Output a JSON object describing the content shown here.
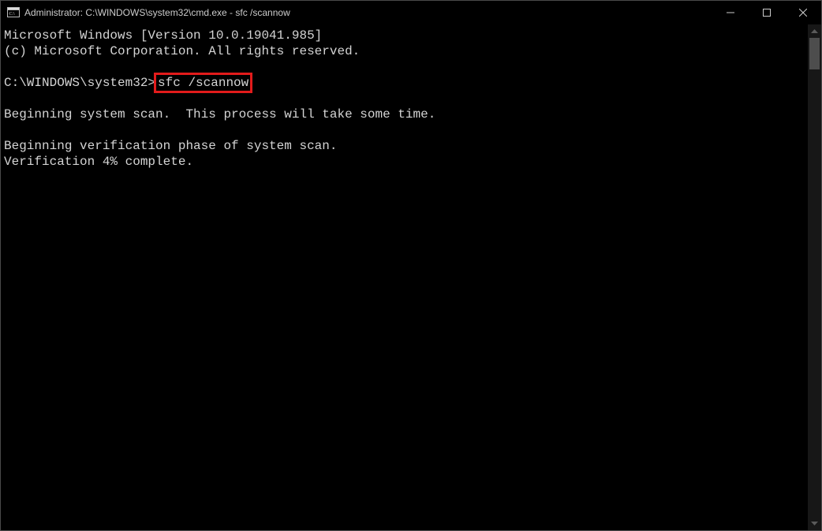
{
  "window": {
    "title": "Administrator: C:\\WINDOWS\\system32\\cmd.exe - sfc  /scannow"
  },
  "console": {
    "line1": "Microsoft Windows [Version 10.0.19041.985]",
    "line2": "(c) Microsoft Corporation. All rights reserved.",
    "blank1": "",
    "prompt": "C:\\WINDOWS\\system32>",
    "command": "sfc /scannow",
    "blank2": "",
    "line3": "Beginning system scan.  This process will take some time.",
    "blank3": "",
    "line4": "Beginning verification phase of system scan.",
    "line5": "Verification 4% complete."
  }
}
